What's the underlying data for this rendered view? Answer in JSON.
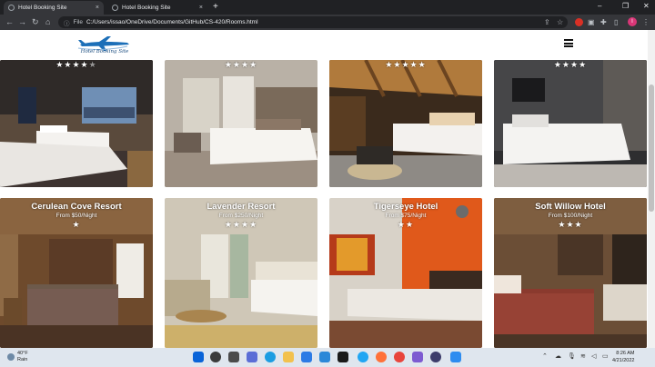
{
  "browser": {
    "tabs": [
      {
        "label": "Hotel Booking Site",
        "close": "×"
      },
      {
        "label": "Hotel Booking Site",
        "close": "×"
      }
    ],
    "new_tab": "+",
    "window_controls": {
      "minimize": "–",
      "maximize": "❐",
      "close": "✕"
    },
    "nav": {
      "back": "←",
      "forward": "→",
      "reload": "↻",
      "home": "⌂"
    },
    "address": {
      "scheme": "File",
      "url": "C:/Users/issao/OneDrive/Documents/GitHub/CS-420/Rooms.html"
    },
    "profile_initial": "I"
  },
  "site": {
    "logo_text": "Hotel Booking Site"
  },
  "top_row": [
    {
      "rating": 4,
      "stars_filled": "★★★★",
      "stars_empty": "★"
    },
    {
      "rating": 4,
      "stars_filled": "★★★★",
      "stars_empty": ""
    },
    {
      "rating": 5,
      "stars_filled": "★★★★★",
      "stars_empty": ""
    },
    {
      "rating": 4,
      "stars_filled": "★★★★",
      "stars_empty": ""
    }
  ],
  "hotels": [
    {
      "name": "Cerulean Cove Resort",
      "price": "From $50/Night",
      "rating": 1,
      "stars_filled": "★",
      "stars_empty": ""
    },
    {
      "name": "Lavender Resort",
      "price": "From $250/Night",
      "rating": 4,
      "stars_filled": "★★★★",
      "stars_empty": ""
    },
    {
      "name": "Tigerseye Hotel",
      "price": "From $75/Night",
      "rating": 2,
      "stars_filled": "★★",
      "stars_empty": ""
    },
    {
      "name": "Soft Willow Hotel",
      "price": "From $100/Night",
      "rating": 3,
      "stars_filled": "★★★",
      "stars_empty": ""
    }
  ],
  "taskbar": {
    "weather_temp": "40°F",
    "weather_desc": "Rain",
    "time": "8:26 AM",
    "date": "4/21/2022"
  },
  "colors": {
    "accent_orange": "#e0591b",
    "brand_blue": "#1c4e80"
  }
}
